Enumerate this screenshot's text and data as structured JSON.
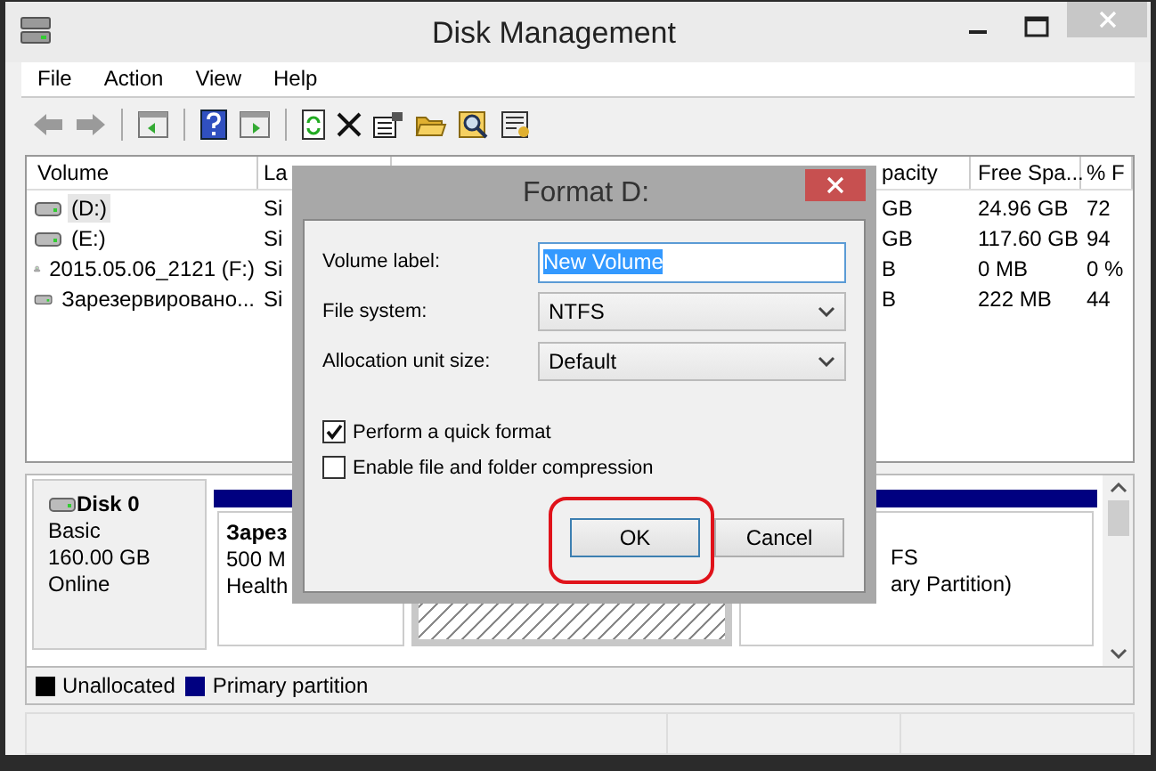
{
  "window": {
    "title": "Disk Management"
  },
  "menu": [
    "File",
    "Action",
    "View",
    "Help"
  ],
  "volume_list": {
    "columns": [
      {
        "label": "Volume"
      },
      {
        "label": "La"
      },
      {
        "label": "pacity"
      },
      {
        "label": "Free Spa..."
      },
      {
        "label": "% F"
      }
    ],
    "rows": [
      {
        "kind": "drive",
        "volume": "(D:)",
        "layout": "Si",
        "capacity": "GB",
        "free": "24.96 GB",
        "percent": "72",
        "selected": true
      },
      {
        "kind": "drive",
        "volume": "(E:)",
        "layout": "Si",
        "capacity": "GB",
        "free": "117.60 GB",
        "percent": "94",
        "selected": false
      },
      {
        "kind": "disc",
        "volume": "2015.05.06_2121 (F:)",
        "layout": "Si",
        "capacity": "B",
        "free": "0 MB",
        "percent": "0 %",
        "selected": false
      },
      {
        "kind": "drive",
        "volume": "Зарезервировано...",
        "layout": "Si",
        "capacity": "B",
        "free": "222 MB",
        "percent": "44",
        "selected": false
      }
    ]
  },
  "disk": {
    "name": "Disk 0",
    "type": "Basic",
    "size": "160.00 GB",
    "status": "Online",
    "partitions": [
      {
        "lines": [
          "Зарез",
          "500 M",
          "Health"
        ],
        "selected": false
      },
      {
        "selected": true
      },
      {
        "lines": [
          "FS",
          "ary Partition)"
        ],
        "selected": false
      }
    ]
  },
  "legend": [
    {
      "label": "Unallocated",
      "color": "#000000"
    },
    {
      "label": "Primary partition",
      "color": "#000080"
    }
  ],
  "dialog": {
    "title": "Format D:",
    "fields": [
      {
        "kind": "text",
        "label": "Volume label:",
        "value": "New Volume"
      },
      {
        "kind": "select",
        "label": "File system:",
        "value": "NTFS"
      },
      {
        "kind": "select",
        "label": "Allocation unit size:",
        "value": "Default"
      }
    ],
    "options": [
      {
        "label": "Perform a quick format",
        "checked": true
      },
      {
        "label": "Enable file and folder compression",
        "checked": false
      }
    ],
    "buttons": [
      {
        "label": "OK",
        "highlighted": true
      },
      {
        "label": "Cancel",
        "highlighted": false
      }
    ]
  }
}
